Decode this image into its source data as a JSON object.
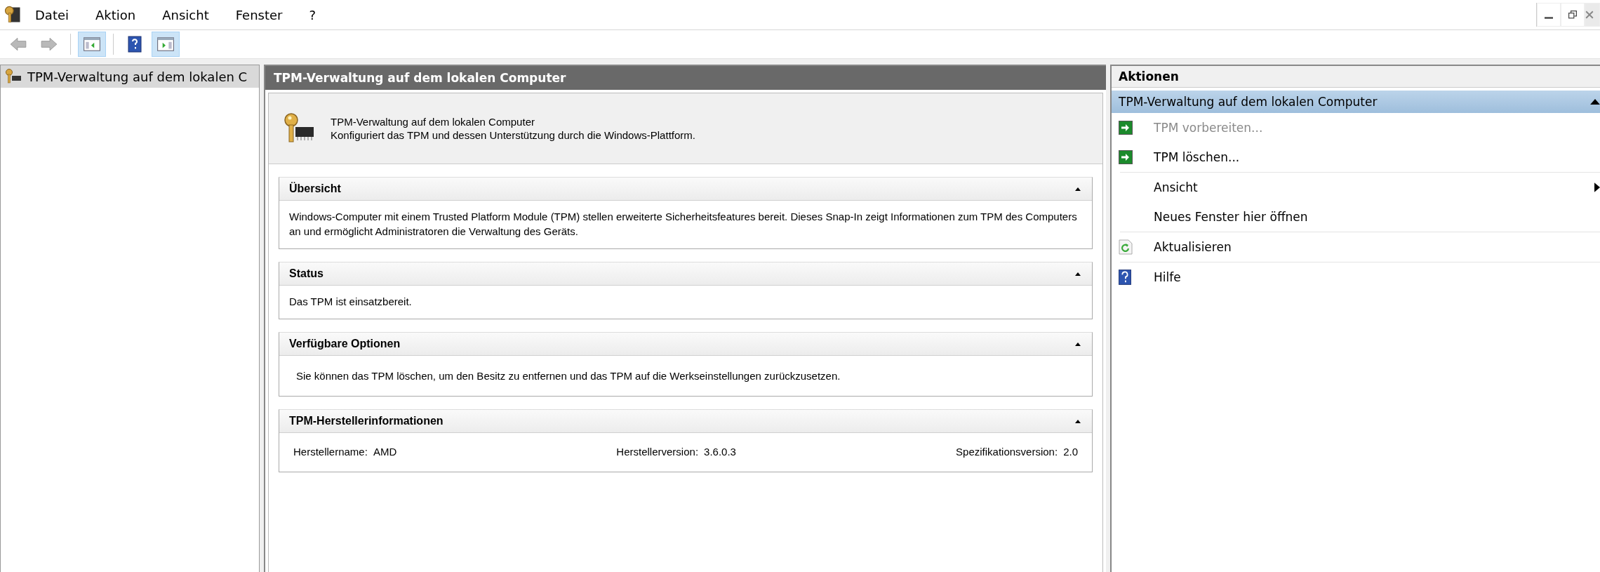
{
  "menu": [
    "Datei",
    "Aktion",
    "Ansicht",
    "Fenster",
    "?"
  ],
  "toolbar": [
    {
      "kind": "back",
      "on": false,
      "disabled": true
    },
    {
      "kind": "forward",
      "on": false,
      "disabled": true
    },
    {
      "kind": "tree-toggle",
      "on": true,
      "disabled": false
    },
    {
      "kind": "help",
      "on": false,
      "disabled": false
    },
    {
      "kind": "action-toggle",
      "on": true,
      "disabled": false
    }
  ],
  "tree": {
    "items": [
      {
        "label": "TPM-Verwaltung auf dem lokalen C",
        "selected": true
      }
    ]
  },
  "main": {
    "title": "TPM-Verwaltung auf dem lokalen Computer",
    "intro_title": "TPM-Verwaltung auf dem lokalen Computer",
    "intro_text": "Konfiguriert das TPM und dessen Unterstützung durch die Windows-Plattform.",
    "sections": [
      {
        "kind": "text",
        "title": "Übersicht",
        "expanded": true,
        "text": "Windows-Computer mit einem Trusted Platform Module (TPM) stellen erweiterte Sicherheitsfeatures bereit. Dieses Snap-In zeigt Informationen zum TPM des Computers an und ermöglicht Administratoren die Verwaltung des Geräts."
      },
      {
        "kind": "text",
        "title": "Status",
        "expanded": true,
        "text": "Das TPM ist einsatzbereit."
      },
      {
        "kind": "option",
        "title": "Verfügbare Optionen",
        "expanded": true,
        "text": "Sie können das TPM löschen, um den Besitz zu entfernen und das TPM auf die Werkseinstellungen zurückzusetzen."
      },
      {
        "kind": "fields",
        "title": "TPM-Herstellerinformationen",
        "expanded": true,
        "fields": [
          {
            "label": "Herstellername:",
            "value": "AMD"
          },
          {
            "label": "Herstellerversion:",
            "value": "3.6.0.3"
          },
          {
            "label": "Spezifikationsversion:",
            "value": "2.0"
          }
        ]
      }
    ]
  },
  "actions": {
    "title": "Aktionen",
    "group": {
      "title": "TPM-Verwaltung auf dem lokalen Computer",
      "expanded": true
    },
    "items": [
      {
        "label": "TPM vorbereiten...",
        "kind": "task",
        "disabled": true,
        "submenu": false,
        "divider_after": false
      },
      {
        "label": "TPM löschen...",
        "kind": "task",
        "disabled": false,
        "submenu": false,
        "divider_after": true
      },
      {
        "label": "Ansicht",
        "kind": "plain",
        "disabled": false,
        "submenu": true,
        "divider_after": false
      },
      {
        "label": "Neues Fenster hier öffnen",
        "kind": "plain",
        "disabled": false,
        "submenu": false,
        "divider_after": true
      },
      {
        "label": "Aktualisieren",
        "kind": "refresh",
        "disabled": false,
        "submenu": false,
        "divider_after": true
      },
      {
        "label": "Hilfe",
        "kind": "help",
        "disabled": false,
        "submenu": false,
        "divider_after": false
      }
    ]
  }
}
